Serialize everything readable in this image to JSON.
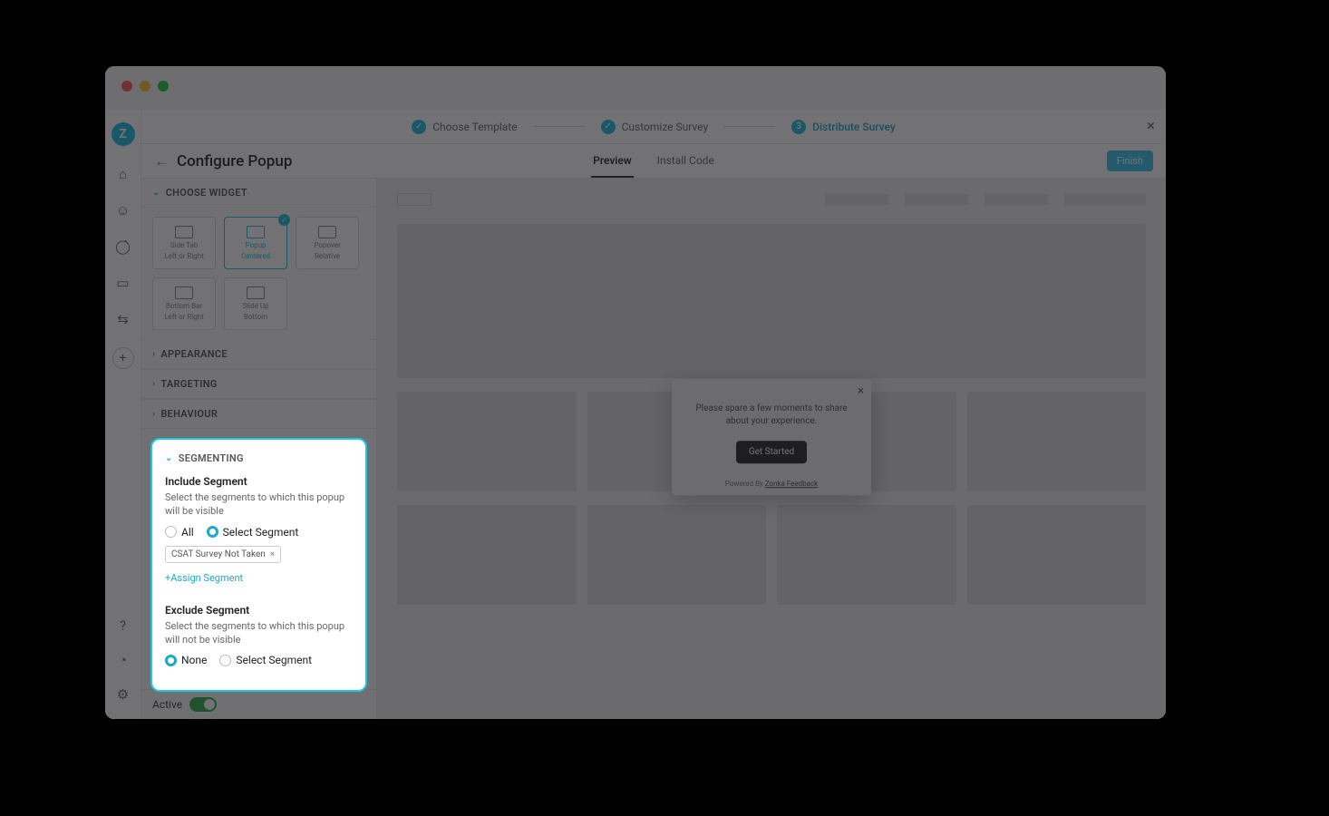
{
  "steps": {
    "s1": "Choose Template",
    "s2": "Customize Survey",
    "s3": "Distribute Survey",
    "n3": "3"
  },
  "header": {
    "title": "Configure Popup",
    "tab_preview": "Preview",
    "tab_install": "Install Code",
    "finish": "Finish"
  },
  "sections": {
    "choose_widget": "CHOOSE WIDGET",
    "appearance": "APPEARANCE",
    "targeting": "TARGETING",
    "behaviour": "BEHAVIOUR",
    "segmenting": "SEGMENTING"
  },
  "widgets": {
    "side_tab": "Side Tab",
    "side_tab_sub": "Left or Right",
    "popup": "Popup",
    "popup_sub": "Centered",
    "popover": "Popover",
    "popover_sub": "Relative",
    "bottom_bar": "Bottom Bar",
    "bottom_bar_sub": "Left or Right",
    "slide_up": "Slide Up",
    "slide_up_sub": "Bottom"
  },
  "segmenting": {
    "include_title": "Include Segment",
    "include_desc": "Select the segments to which this popup will be visible",
    "opt_all": "All",
    "opt_select": "Select Segment",
    "tag1": "CSAT Survey Not Taken",
    "assign": "+Assign Segment",
    "exclude_title": "Exclude Segment",
    "exclude_desc": "Select the segments to which this popup will not be visible",
    "opt_none": "None"
  },
  "footer": {
    "active": "Active"
  },
  "popup": {
    "text": "Please spare a few moments to share about your experience.",
    "cta": "Get Started",
    "powered_prefix": "Powered By ",
    "powered_brand": "Zonka Feedback"
  }
}
